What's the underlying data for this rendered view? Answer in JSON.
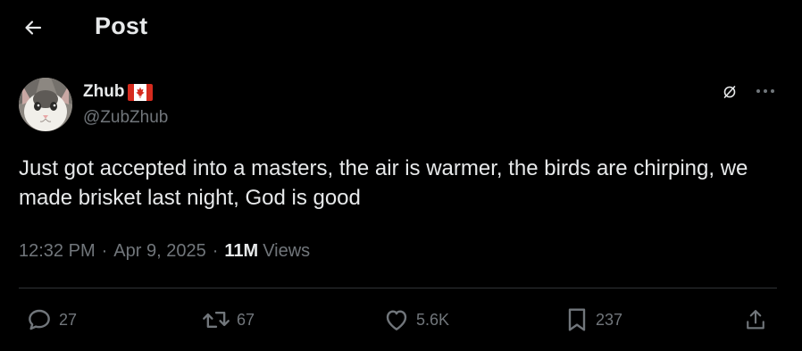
{
  "header": {
    "title": "Post",
    "back_icon": "arrow-left-icon"
  },
  "author": {
    "display_name": "Zhub",
    "flag": "canada-flag",
    "handle": "@ZubZhub",
    "avatar": "cat-avatar"
  },
  "post": {
    "text": "Just got accepted into a masters, the air is warmer, the birds are chirping, we made brisket last night, God is good",
    "time": "12:32 PM",
    "date": "Apr 9, 2025",
    "separator": "·",
    "views_count": "11M",
    "views_label": "Views"
  },
  "actions": {
    "replies": "27",
    "reposts": "67",
    "likes": "5.6K",
    "bookmarks": "237"
  },
  "colors": {
    "background": "#000000",
    "text": "#e7e9ea",
    "muted": "#71767b",
    "divider": "#2f3336"
  }
}
